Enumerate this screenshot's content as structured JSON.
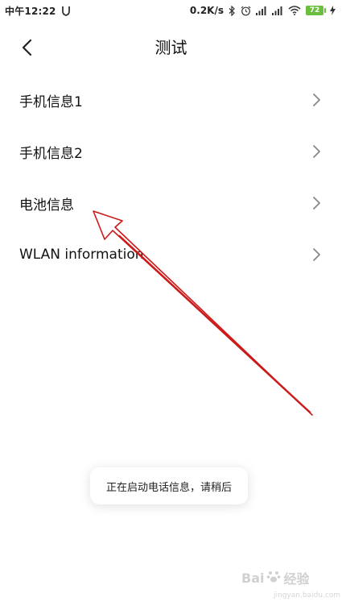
{
  "status_bar": {
    "time": "中午12:22",
    "network_speed": "0.2K/s",
    "battery_level": "72",
    "icons": [
      "shield-icon",
      "bluetooth-icon",
      "alarm-icon",
      "signal-icon",
      "signal-icon",
      "wifi-icon",
      "battery-icon",
      "charging-icon"
    ]
  },
  "header": {
    "title": "测试",
    "back_icon": "chevron-left-icon"
  },
  "list": {
    "items": [
      {
        "label": "手机信息1"
      },
      {
        "label": "手机信息2"
      },
      {
        "label": "电池信息"
      },
      {
        "label": "WLAN information"
      }
    ],
    "item_icon": "chevron-right-icon"
  },
  "toast": {
    "message": "正在启动电话信息，请稍后"
  },
  "watermark": {
    "brand": "Bai",
    "brand_suffix": "经验",
    "url": "jingyan.baidu.com"
  },
  "colors": {
    "annotation_arrow": "#cc1a1a",
    "battery": "#6abf3f",
    "chevron": "#888888"
  }
}
